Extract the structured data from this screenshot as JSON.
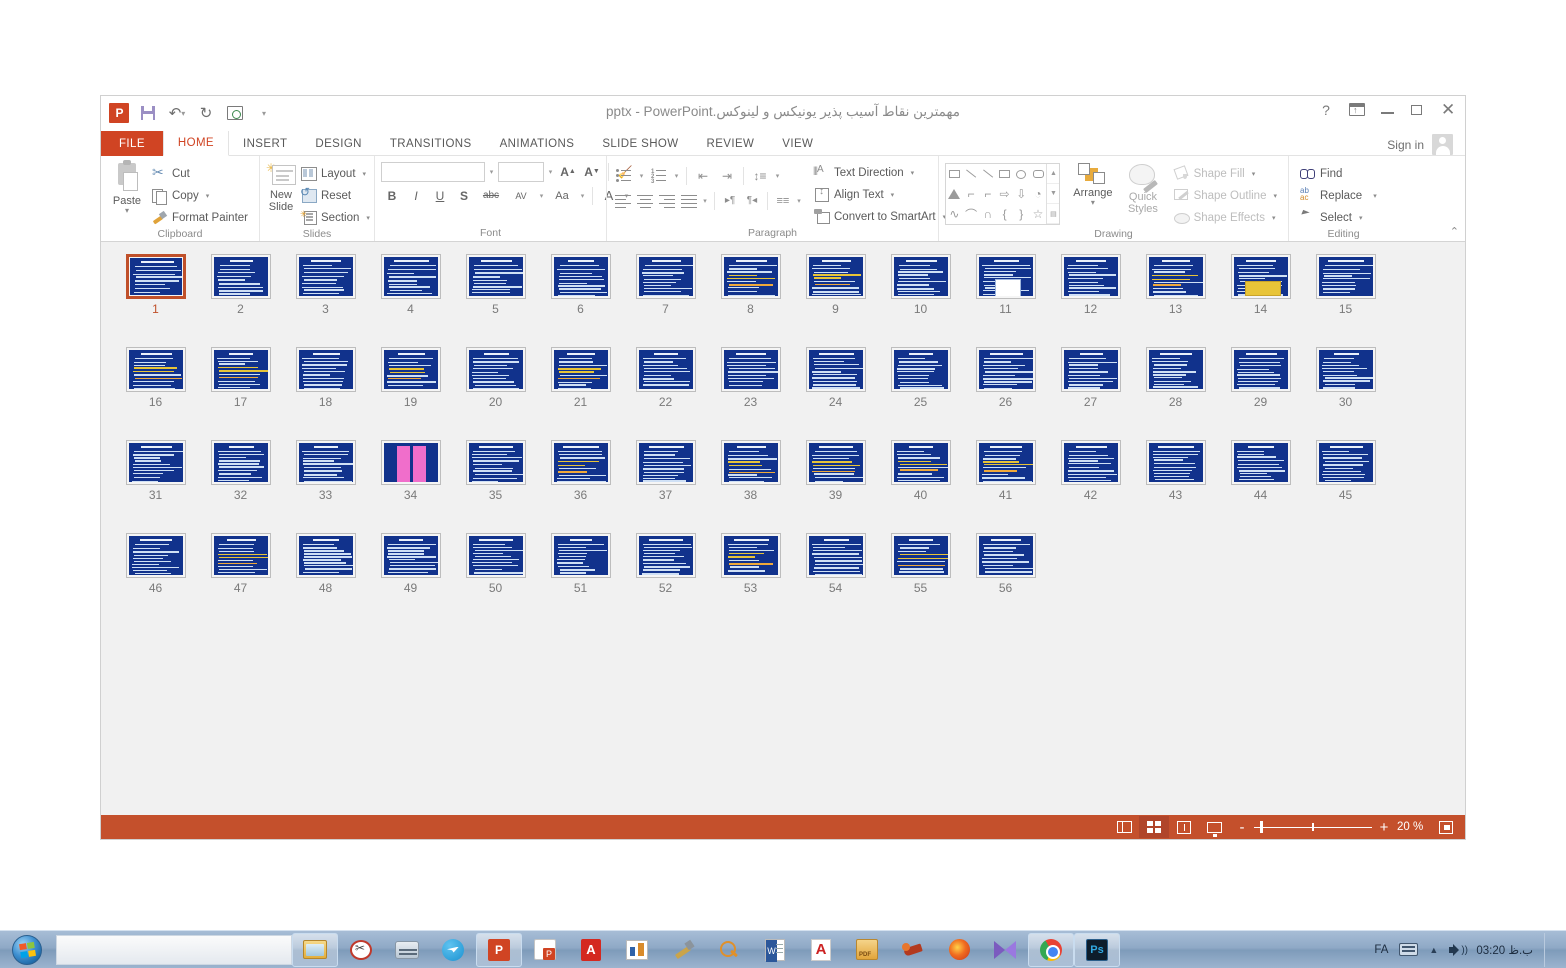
{
  "window": {
    "title": "مهمترین نقاط آسیب پذیر یونیکس و لینوکس.pptx - PowerPoint",
    "app_logo": "P",
    "signin_label": "Sign in",
    "help_icon": "?",
    "ribbon_display_icon": "ribbon-display-options-icon",
    "minimize_icon": "minimize-icon",
    "restore_icon": "restore-icon",
    "close_icon": "close-icon"
  },
  "quick_access": {
    "save_icon": "save-icon",
    "undo_icon": "undo-icon",
    "redo_icon": "redo-icon",
    "start_presentation_icon": "start-from-beginning-icon",
    "customize_icon": "customize-quick-access-toolbar-icon"
  },
  "tabs": [
    {
      "label": "FILE",
      "active": false,
      "file": true
    },
    {
      "label": "HOME",
      "active": true
    },
    {
      "label": "INSERT",
      "active": false
    },
    {
      "label": "DESIGN",
      "active": false
    },
    {
      "label": "TRANSITIONS",
      "active": false
    },
    {
      "label": "ANIMATIONS",
      "active": false
    },
    {
      "label": "SLIDE SHOW",
      "active": false
    },
    {
      "label": "REVIEW",
      "active": false
    },
    {
      "label": "VIEW",
      "active": false
    }
  ],
  "ribbon": {
    "groups": [
      {
        "name": "Clipboard",
        "label": "Clipboard"
      },
      {
        "name": "Slides",
        "label": "Slides"
      },
      {
        "name": "Font",
        "label": "Font"
      },
      {
        "name": "Paragraph",
        "label": "Paragraph"
      },
      {
        "name": "Drawing",
        "label": "Drawing"
      },
      {
        "name": "Editing",
        "label": "Editing"
      }
    ],
    "clipboard": {
      "paste": "Paste",
      "cut": "Cut",
      "copy": "Copy",
      "format_painter": "Format Painter"
    },
    "slides": {
      "new_slide": "New\nSlide",
      "new_slide_line1": "New",
      "new_slide_line2": "Slide",
      "layout": "Layout",
      "reset": "Reset",
      "section": "Section"
    },
    "font": {
      "font_name_value": "",
      "font_size_value": "",
      "bold": "B",
      "italic": "I",
      "underline": "U",
      "shadow": "S",
      "strikethrough": "abc",
      "character_spacing": "AV",
      "change_case": "Aa",
      "font_color": "A",
      "increase_size": "A",
      "decrease_size": "A",
      "clear_formatting": "clear-formatting-icon"
    },
    "paragraph": {
      "text_direction": "Text Direction",
      "align_text": "Align Text",
      "convert_to_smartart": "Convert to SmartArt"
    },
    "drawing": {
      "arrange": "Arrange",
      "quick_styles_line1": "Quick",
      "quick_styles_line2": "Styles",
      "shape_fill": "Shape Fill",
      "shape_outline": "Shape Outline",
      "shape_effects": "Shape Effects"
    },
    "editing": {
      "find": "Find",
      "replace": "Replace",
      "select": "Select"
    },
    "collapse_icon": "collapse-ribbon-icon"
  },
  "slides": {
    "selected_index": 1,
    "total": 56,
    "items": [
      {
        "n": 1,
        "kind": "title-body"
      },
      {
        "n": 2,
        "kind": "dense"
      },
      {
        "n": 3,
        "kind": "centered"
      },
      {
        "n": 4,
        "kind": "dense"
      },
      {
        "n": 5,
        "kind": "dense"
      },
      {
        "n": 6,
        "kind": "dense"
      },
      {
        "n": 7,
        "kind": "dense"
      },
      {
        "n": 8,
        "kind": "highlight"
      },
      {
        "n": 9,
        "kind": "highlight"
      },
      {
        "n": 10,
        "kind": "dense"
      },
      {
        "n": 11,
        "kind": "table"
      },
      {
        "n": 12,
        "kind": "dense"
      },
      {
        "n": 13,
        "kind": "highlight"
      },
      {
        "n": 14,
        "kind": "highlight-block"
      },
      {
        "n": 15,
        "kind": "dense"
      },
      {
        "n": 16,
        "kind": "highlight"
      },
      {
        "n": 17,
        "kind": "highlight"
      },
      {
        "n": 18,
        "kind": "dense"
      },
      {
        "n": 19,
        "kind": "highlight"
      },
      {
        "n": 20,
        "kind": "dense"
      },
      {
        "n": 21,
        "kind": "highlight"
      },
      {
        "n": 22,
        "kind": "dense"
      },
      {
        "n": 23,
        "kind": "dense"
      },
      {
        "n": 24,
        "kind": "dense"
      },
      {
        "n": 25,
        "kind": "dense"
      },
      {
        "n": 26,
        "kind": "dense"
      },
      {
        "n": 27,
        "kind": "dense"
      },
      {
        "n": 28,
        "kind": "dense"
      },
      {
        "n": 29,
        "kind": "dense"
      },
      {
        "n": 30,
        "kind": "dense"
      },
      {
        "n": 31,
        "kind": "dense"
      },
      {
        "n": 32,
        "kind": "dense"
      },
      {
        "n": 33,
        "kind": "dense"
      },
      {
        "n": 34,
        "kind": "pink"
      },
      {
        "n": 35,
        "kind": "dense"
      },
      {
        "n": 36,
        "kind": "highlight"
      },
      {
        "n": 37,
        "kind": "dense"
      },
      {
        "n": 38,
        "kind": "highlight"
      },
      {
        "n": 39,
        "kind": "highlight"
      },
      {
        "n": 40,
        "kind": "highlight"
      },
      {
        "n": 41,
        "kind": "highlight"
      },
      {
        "n": 42,
        "kind": "dense"
      },
      {
        "n": 43,
        "kind": "dense"
      },
      {
        "n": 44,
        "kind": "dense"
      },
      {
        "n": 45,
        "kind": "dense"
      },
      {
        "n": 46,
        "kind": "dense"
      },
      {
        "n": 47,
        "kind": "highlight"
      },
      {
        "n": 48,
        "kind": "dense"
      },
      {
        "n": 49,
        "kind": "dense"
      },
      {
        "n": 50,
        "kind": "dense"
      },
      {
        "n": 51,
        "kind": "dense"
      },
      {
        "n": 52,
        "kind": "dense"
      },
      {
        "n": 53,
        "kind": "highlight"
      },
      {
        "n": 54,
        "kind": "dense"
      },
      {
        "n": 55,
        "kind": "highlight"
      },
      {
        "n": 56,
        "kind": "dense"
      }
    ]
  },
  "status_bar": {
    "zoom_percent": "20 %",
    "view_normal_icon": "normal-view-icon",
    "view_sorter_icon": "slide-sorter-view-icon",
    "view_reading_icon": "reading-view-icon",
    "view_slideshow_icon": "slide-show-icon",
    "zoom_out_icon": "-",
    "zoom_in_icon": "+",
    "fit_icon": "fit-slide-to-window-icon",
    "active_view": "slide-sorter"
  },
  "taskbar": {
    "start_icon": "windows-start-orb-icon",
    "items": [
      {
        "name": "file-explorer-icon",
        "active": true
      },
      {
        "name": "snipping-tool-icon",
        "active": false
      },
      {
        "name": "bank-app-icon",
        "active": false
      },
      {
        "name": "telegram-icon",
        "active": false
      },
      {
        "name": "powerpoint-icon",
        "active": true
      },
      {
        "name": "powerpoint-viewer-icon",
        "active": false
      },
      {
        "name": "adobe-acrobat-icon",
        "active": false
      },
      {
        "name": "chart-app-icon",
        "active": false
      },
      {
        "name": "paint-tool-icon",
        "active": false
      },
      {
        "name": "search-tool-icon",
        "active": false
      },
      {
        "name": "word-icon",
        "active": false
      },
      {
        "name": "adobe-reader-icon",
        "active": false
      },
      {
        "name": "pdf-tool-icon",
        "active": false
      },
      {
        "name": "rocket-app-icon",
        "active": false
      },
      {
        "name": "firefox-icon",
        "active": false
      },
      {
        "name": "media-player-classic-icon",
        "active": false
      },
      {
        "name": "chrome-icon",
        "active": true
      },
      {
        "name": "photoshop-icon",
        "active": true
      }
    ],
    "tray": {
      "language": "FA",
      "keyboard_icon": "keyboard-layout-icon",
      "show_hidden_icon": "show-hidden-icons-icon",
      "volume_icon": "volume-icon",
      "clock": "03:20 ب.ظ"
    }
  },
  "colors": {
    "accent": "#d04423",
    "status_bar": "#c4502c",
    "slide_bg": "#11328c",
    "selection": "#c0502a",
    "canvas": "#f1f1f1"
  }
}
